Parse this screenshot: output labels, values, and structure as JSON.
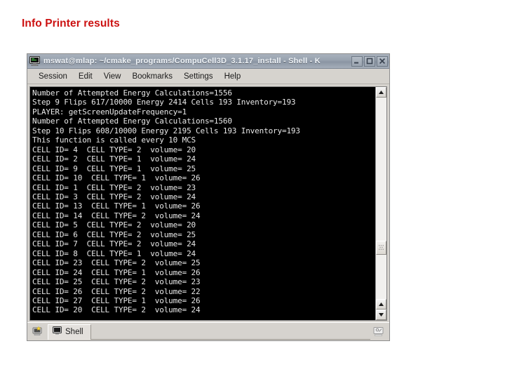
{
  "slide": {
    "title": "Info Printer results",
    "title_color": "#cc1111",
    "background": "#ffffff"
  },
  "window": {
    "titlebar": {
      "icon": "terminal-monitor-icon",
      "text": "mswat@mlap: ~/cmake_programs/CompuCell3D_3.1.17_install - Shell - K",
      "buttons": [
        {
          "name": "minimize",
          "glyph": "minimize-icon"
        },
        {
          "name": "maximize",
          "glyph": "maximize-icon"
        },
        {
          "name": "close",
          "glyph": "close-icon"
        }
      ]
    },
    "menubar": {
      "items": [
        {
          "label": "Session"
        },
        {
          "label": "Edit"
        },
        {
          "label": "View"
        },
        {
          "label": "Bookmarks"
        },
        {
          "label": "Settings"
        },
        {
          "label": "Help"
        }
      ]
    },
    "terminal": {
      "background": "#000000",
      "foreground": "#e8e8e8",
      "lines": [
        "Number of Attempted Energy Calculations=1556",
        "Step 9 Flips 617/10000 Energy 2414 Cells 193 Inventory=193",
        "PLAYER: getScreenUpdateFrequency=1",
        "Number of Attempted Energy Calculations=1560",
        "Step 10 Flips 608/10000 Energy 2195 Cells 193 Inventory=193",
        "This function is called every 10 MCS",
        "CELL ID= 4  CELL TYPE= 2  volume= 20",
        "CELL ID= 2  CELL TYPE= 1  volume= 24",
        "CELL ID= 9  CELL TYPE= 1  volume= 25",
        "CELL ID= 10  CELL TYPE= 1  volume= 26",
        "CELL ID= 1  CELL TYPE= 2  volume= 23",
        "CELL ID= 3  CELL TYPE= 2  volume= 24",
        "CELL ID= 13  CELL TYPE= 1  volume= 26",
        "CELL ID= 14  CELL TYPE= 2  volume= 24",
        "CELL ID= 5  CELL TYPE= 2  volume= 20",
        "CELL ID= 6  CELL TYPE= 2  volume= 25",
        "CELL ID= 7  CELL TYPE= 2  volume= 24",
        "CELL ID= 8  CELL TYPE= 1  volume= 24",
        "CELL ID= 23  CELL TYPE= 2  volume= 25",
        "CELL ID= 24  CELL TYPE= 1  volume= 26",
        "CELL ID= 25  CELL TYPE= 2  volume= 23",
        "CELL ID= 26  CELL TYPE= 2  volume= 22",
        "CELL ID= 27  CELL TYPE= 1  volume= 26",
        "CELL ID= 20  CELL TYPE= 2  volume= 24"
      ]
    },
    "scrollbar": {
      "up_arrow": "scroll-up-icon",
      "down_arrow": "scroll-down-icon",
      "thumb_position_percent": 71
    },
    "tabbar": {
      "new_tab_icon": "new-session-icon",
      "tabs": [
        {
          "label": "Shell",
          "icon": "terminal-monitor-icon",
          "active": true
        }
      ],
      "right_icon": "session-settings-icon"
    }
  }
}
